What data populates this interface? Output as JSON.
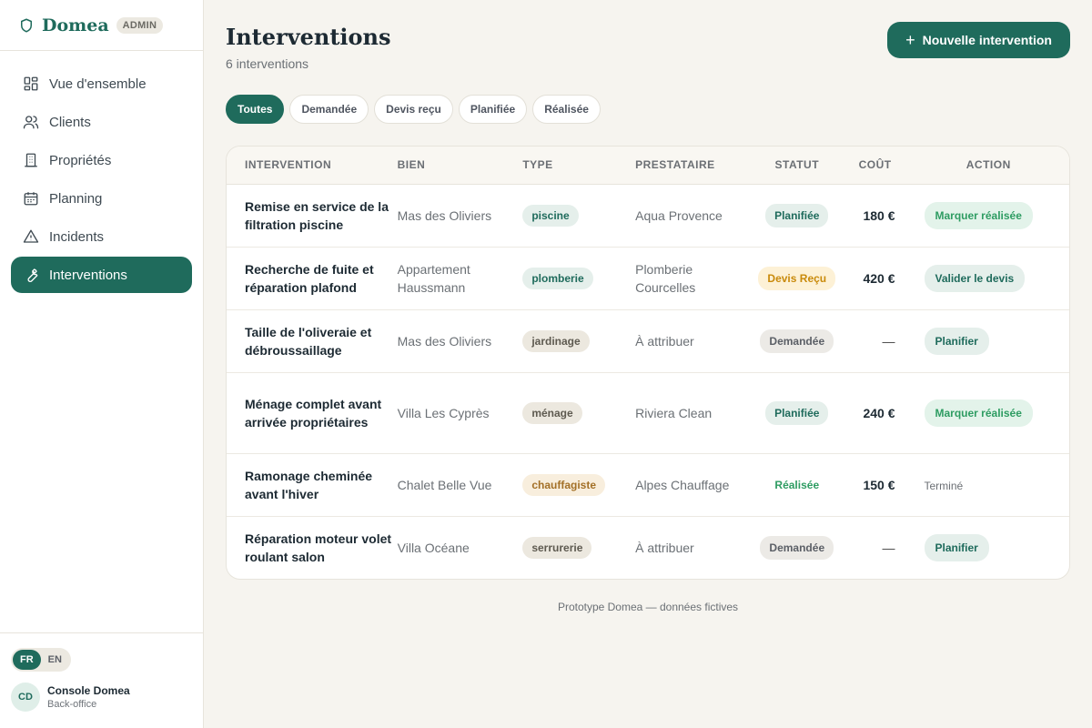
{
  "brand": {
    "name": "Domea",
    "badge": "ADMIN"
  },
  "nav": {
    "items": [
      {
        "label": "Vue d'ensemble",
        "icon": "dashboard-icon"
      },
      {
        "label": "Clients",
        "icon": "users-icon"
      },
      {
        "label": "Propriétés",
        "icon": "building-icon"
      },
      {
        "label": "Planning",
        "icon": "calendar-icon"
      },
      {
        "label": "Incidents",
        "icon": "warning-icon"
      },
      {
        "label": "Interventions",
        "icon": "wrench-icon",
        "active": true
      }
    ]
  },
  "lang": {
    "fr": "FR",
    "en": "EN",
    "active": "FR"
  },
  "user": {
    "initials": "CD",
    "name": "Console Domea",
    "role": "Back-office"
  },
  "page": {
    "title": "Interventions",
    "subtitle": "6 interventions",
    "new_button": "Nouvelle intervention"
  },
  "filters": [
    "Toutes",
    "Demandée",
    "Devis reçu",
    "Planifiée",
    "Réalisée"
  ],
  "table": {
    "headers": [
      "INTERVENTION",
      "BIEN",
      "TYPE",
      "PRESTATAIRE",
      "STATUT",
      "COÛT",
      "ACTION"
    ],
    "rows": [
      {
        "intervention": "Remise en service de la filtration piscine",
        "bien": "Mas des Oliviers",
        "type": "piscine",
        "prestataire": "Aqua Provence",
        "statut": "Planifiée",
        "cout": "180 €",
        "action": "Marquer réalisée"
      },
      {
        "intervention": "Recherche de fuite et réparation plafond",
        "bien": "Appartement Haussmann",
        "type": "plomberie",
        "prestataire": "Plomberie Courcelles",
        "statut": "Devis Reçu",
        "cout": "420 €",
        "action": "Valider le devis"
      },
      {
        "intervention": "Taille de l'oliveraie et débroussaillage",
        "bien": "Mas des Oliviers",
        "type": "jardinage",
        "prestataire": "À attribuer",
        "statut": "Demandée",
        "cout": "—",
        "action": "Planifier"
      },
      {
        "intervention": "Ménage complet avant arrivée propriétaires",
        "bien": "Villa Les Cyprès",
        "type": "ménage",
        "prestataire": "Riviera Clean",
        "statut": "Planifiée",
        "cout": "240 €",
        "action": "Marquer réalisée"
      },
      {
        "intervention": "Ramonage cheminée avant l'hiver",
        "bien": "Chalet Belle Vue",
        "type": "chauffagiste",
        "prestataire": "Alpes Chauffage",
        "statut": "Réalisée",
        "cout": "150 €",
        "action": "Terminé"
      },
      {
        "intervention": "Réparation moteur volet roulant salon",
        "bien": "Villa Océane",
        "type": "serrurerie",
        "prestataire": "À attribuer",
        "statut": "Demandée",
        "cout": "—",
        "action": "Planifier"
      }
    ]
  },
  "footer": "Prototype Domea — données fictives",
  "colors": {
    "accent": "#1f6b5c",
    "background": "#f6f4ef",
    "warning": "#c98a0b",
    "success": "#2e9c62"
  }
}
